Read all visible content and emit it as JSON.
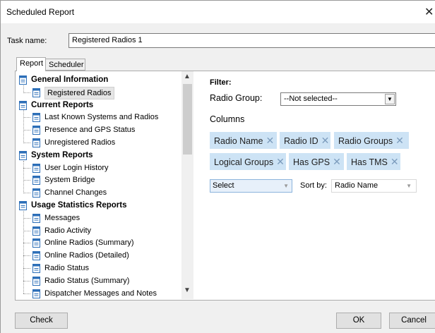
{
  "window": {
    "title": "Scheduled Report",
    "close_glyph": "✕"
  },
  "task": {
    "label": "Task name:",
    "value": "Registered Radios 1"
  },
  "tabs": [
    {
      "label": "Report",
      "active": true
    },
    {
      "label": "Scheduler",
      "active": false
    }
  ],
  "tree": [
    {
      "label": "General Information",
      "type": "category"
    },
    {
      "label": "Registered Radios",
      "type": "item",
      "selected": true
    },
    {
      "label": "Current Reports",
      "type": "category"
    },
    {
      "label": "Last Known Systems and Radios",
      "type": "item"
    },
    {
      "label": "Presence and GPS Status",
      "type": "item"
    },
    {
      "label": "Unregistered Radios",
      "type": "item"
    },
    {
      "label": "System Reports",
      "type": "category"
    },
    {
      "label": "User Login History",
      "type": "item"
    },
    {
      "label": "System Bridge",
      "type": "item"
    },
    {
      "label": "Channel Changes",
      "type": "item"
    },
    {
      "label": "Usage Statistics Reports",
      "type": "category"
    },
    {
      "label": "Messages",
      "type": "item"
    },
    {
      "label": "Radio Activity",
      "type": "item"
    },
    {
      "label": "Online Radios (Summary)",
      "type": "item"
    },
    {
      "label": "Online Radios (Detailed)",
      "type": "item"
    },
    {
      "label": "Radio Status",
      "type": "item"
    },
    {
      "label": "Radio Status (Summary)",
      "type": "item"
    },
    {
      "label": "Dispatcher Messages and Notes",
      "type": "item"
    }
  ],
  "filter": {
    "title": "Filter:",
    "radio_group_label": "Radio Group:",
    "radio_group_value": "--Not selected--",
    "columns_label": "Columns",
    "columns": [
      "Radio Name",
      "Radio ID",
      "Radio Groups",
      "Logical Groups",
      "Has GPS",
      "Has TMS"
    ],
    "chip_remove_glyph": "✕",
    "column_select_value": "Select",
    "sort_by_label": "Sort by:",
    "sort_by_value": "Radio Name"
  },
  "icons": {
    "dropdown": "▼",
    "scroll_up": "▲",
    "scroll_down": "▼"
  },
  "buttons": {
    "check": "Check",
    "ok": "OK",
    "cancel": "Cancel"
  },
  "colors": {
    "chip_bg": "#cde3f5",
    "chip_x": "#7c9cbd",
    "doc_icon_blue": "#2d6fb8"
  }
}
